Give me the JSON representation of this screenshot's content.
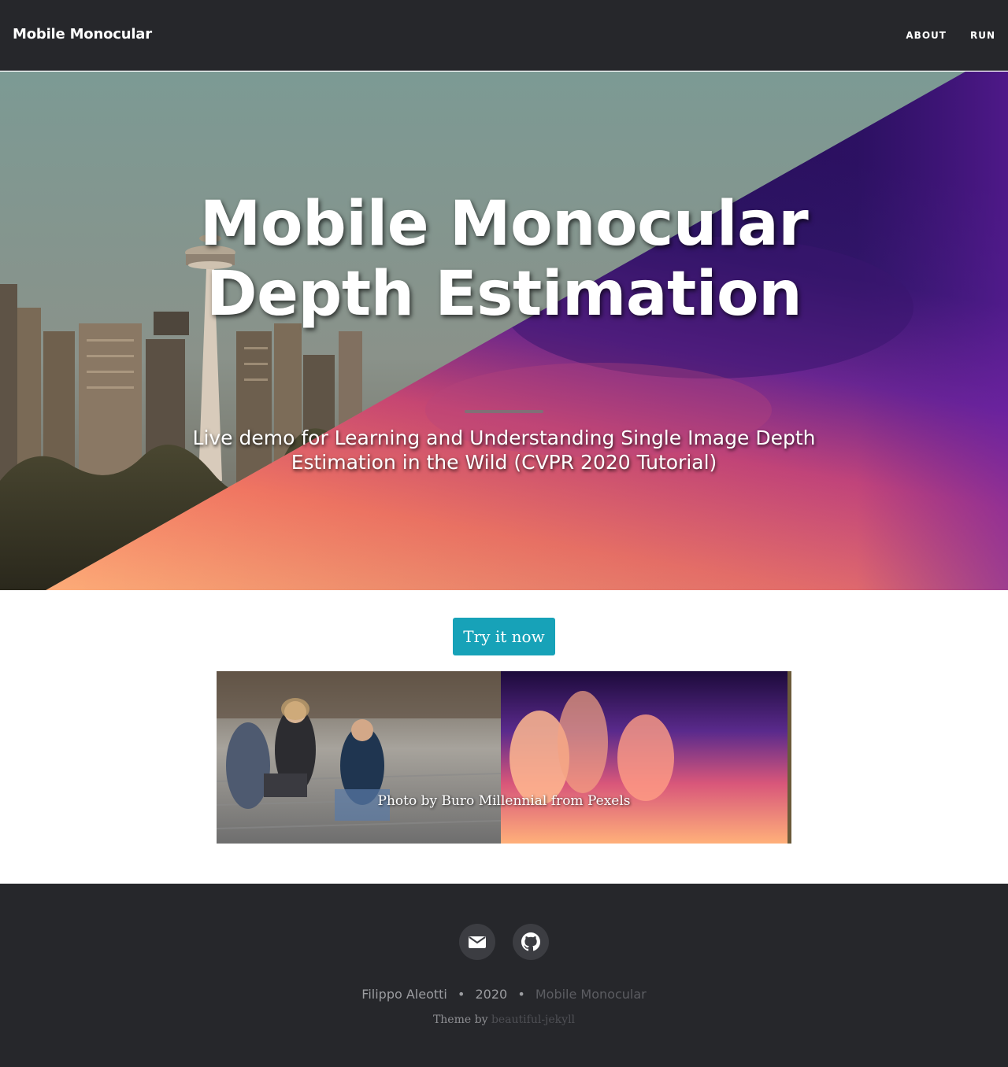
{
  "navbar": {
    "brand": "Mobile Monocular",
    "links": [
      "ABOUT",
      "RUN"
    ]
  },
  "hero": {
    "title": "Mobile Monocular Depth Estimation",
    "subtitle": "Live demo for Learning and Understanding Single Image Depth Estimation in the Wild (CVPR 2020 Tutorial)"
  },
  "main": {
    "try_button": "Try it now",
    "comparison_caption": "Photo by Buro Millennial from Pexels"
  },
  "footer": {
    "social_icons": [
      "envelope-icon",
      "github-icon"
    ],
    "author": "Filippo Aleotti",
    "separator": "•",
    "year": "2020",
    "site_name": "Mobile Monocular",
    "theme_prefix": "Theme by",
    "theme_link": "beautiful-jekyll"
  }
}
